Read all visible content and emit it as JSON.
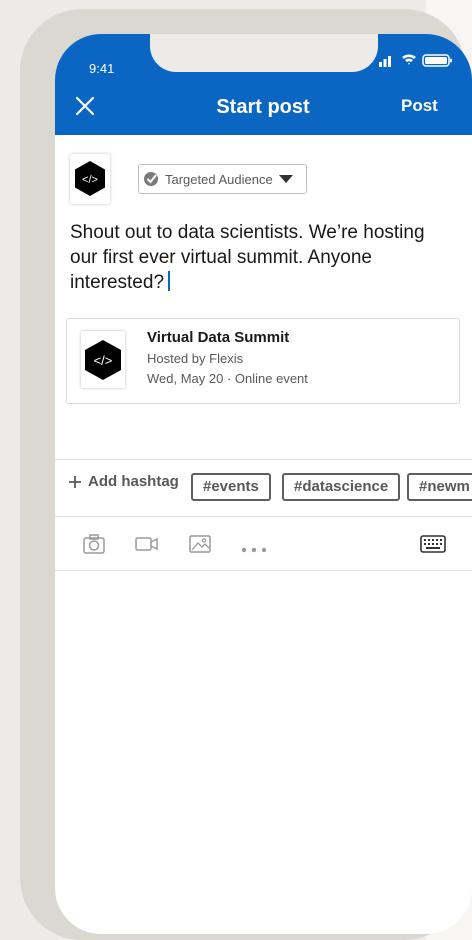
{
  "status_bar": {
    "time": "9:41"
  },
  "header": {
    "title": "Start post",
    "post_label": "Post"
  },
  "audience": {
    "label": "Targeted Audience"
  },
  "post": {
    "text": "Shout out to data scientists. We’re hosting our first ever virtual summit. Anyone interested?"
  },
  "event": {
    "title": "Virtual Data Summit",
    "host": "Hosted by Flexis",
    "date": "Wed, May 20 · Online event"
  },
  "hashtags": {
    "add_label": "Add hashtag",
    "items": [
      "#events",
      "#datascience",
      "#newm"
    ]
  },
  "colors": {
    "brand": "#0a66c2",
    "text": "#191919",
    "muted": "#595959"
  },
  "toolbar": {
    "icons": [
      "camera-icon",
      "video-icon",
      "image-icon",
      "more-icon",
      "keyboard-icon"
    ]
  }
}
